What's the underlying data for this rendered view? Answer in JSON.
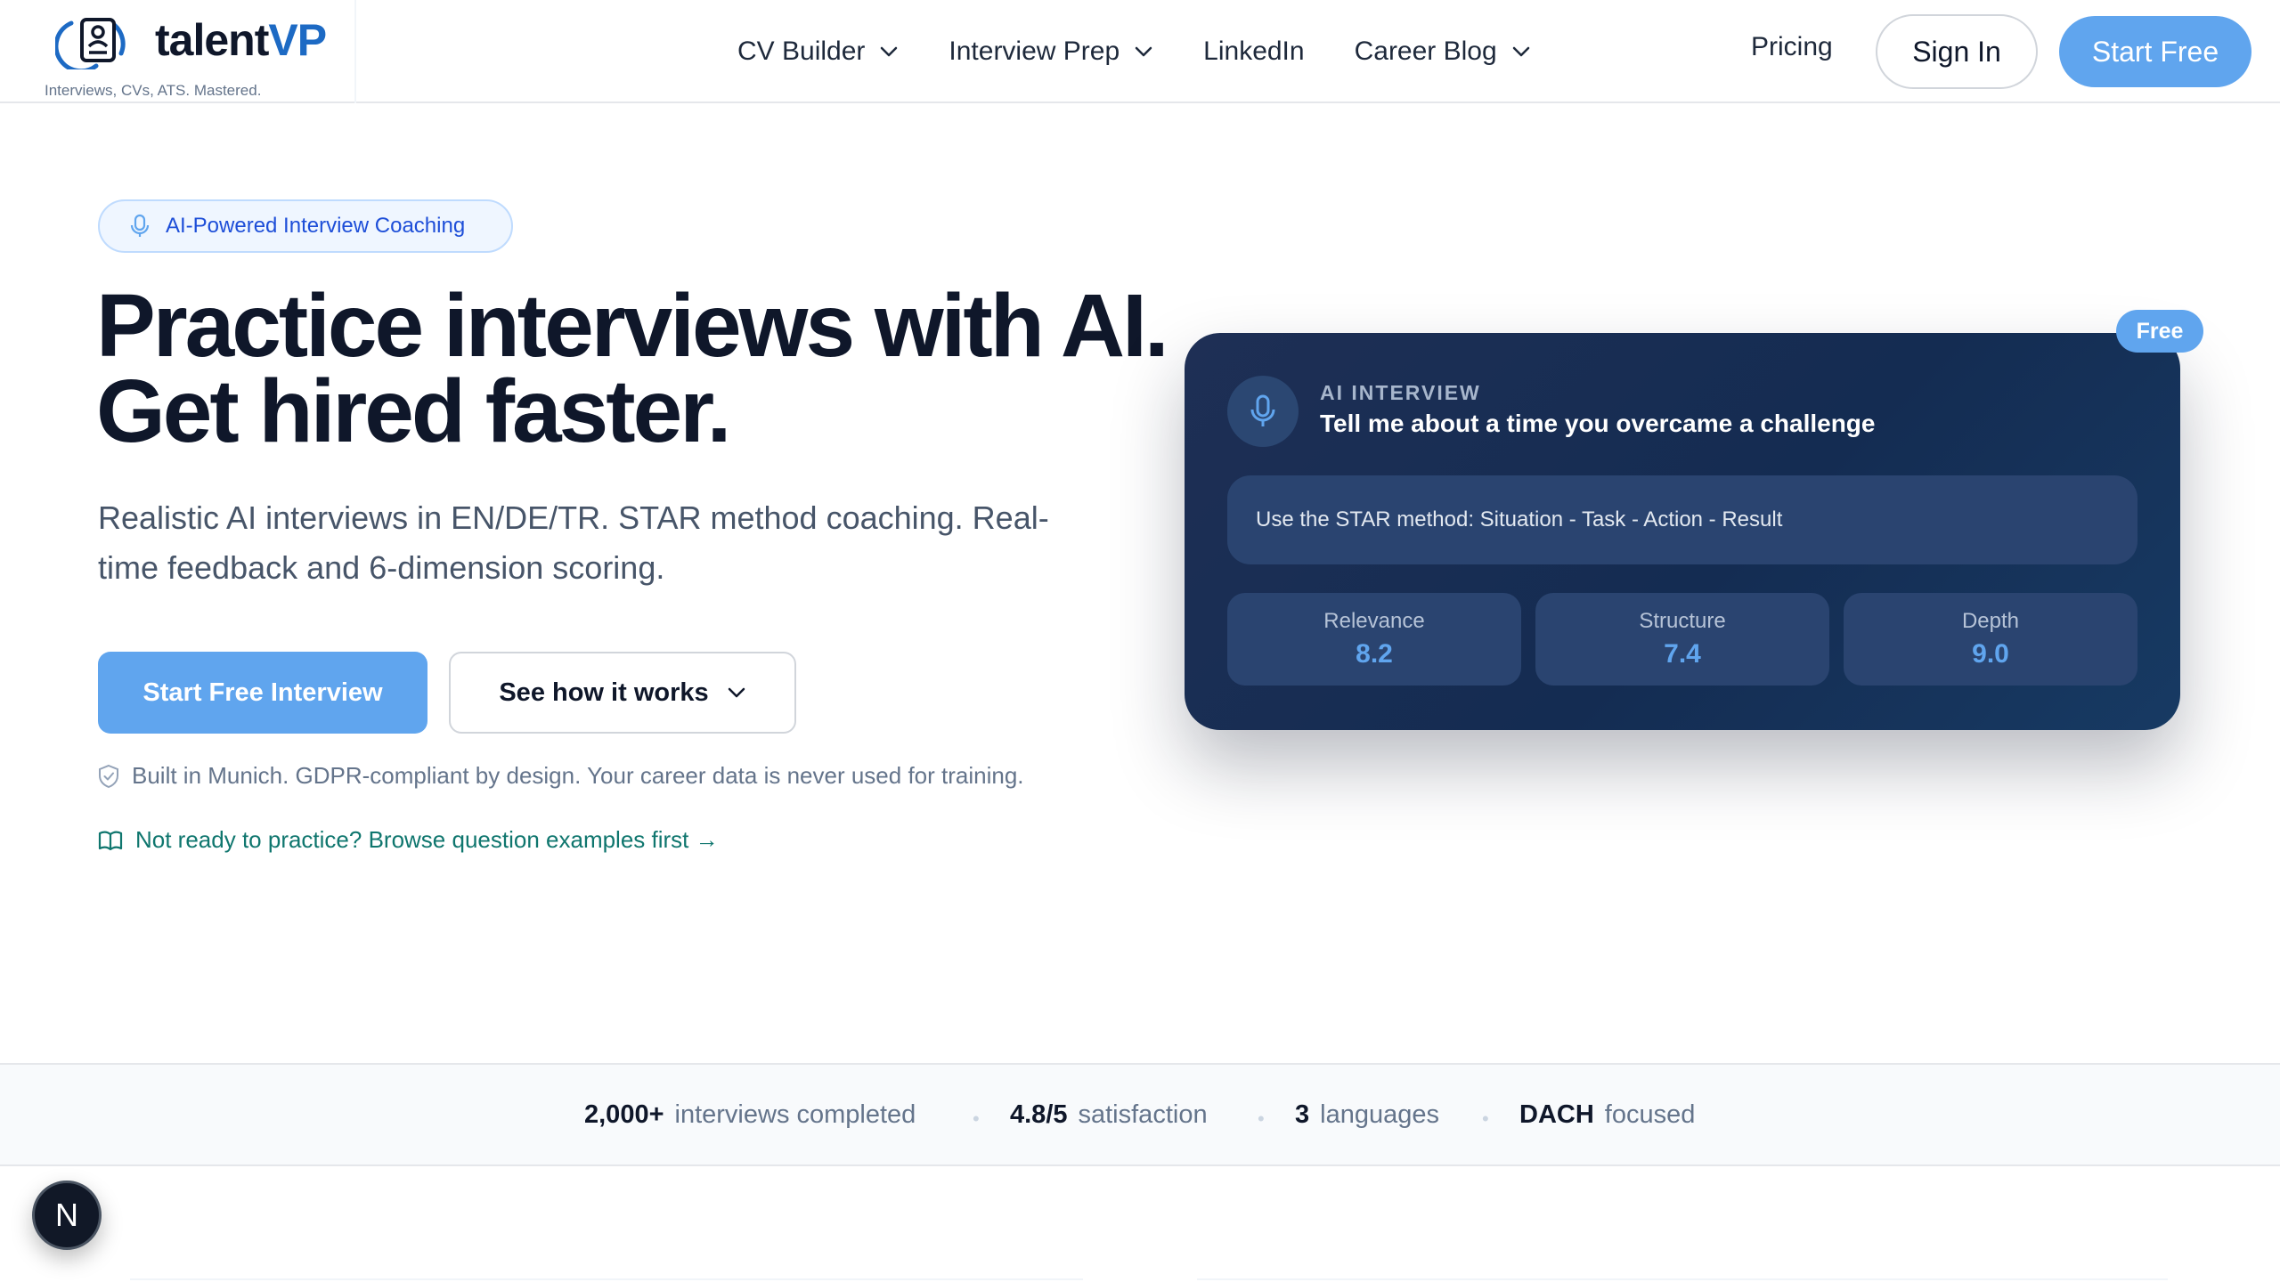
{
  "brand": {
    "name_part1": "talent",
    "name_part2": "VP",
    "tagline": "Interviews, CVs, ATS. Mastered."
  },
  "nav": {
    "items": [
      {
        "label": "CV Builder",
        "has_dropdown": true
      },
      {
        "label": "Interview Prep",
        "has_dropdown": true
      },
      {
        "label": "LinkedIn",
        "has_dropdown": false
      },
      {
        "label": "Career Blog",
        "has_dropdown": true
      }
    ],
    "pricing": "Pricing",
    "sign_in": "Sign In",
    "start_free": "Start Free"
  },
  "hero": {
    "badge": "AI-Powered Interview Coaching",
    "headline_line1": "Practice interviews with AI.",
    "headline_line2": "Get hired faster.",
    "subtext": "Realistic AI interviews in EN/DE/TR. STAR method coaching. Real-time feedback and 6-dimension scoring.",
    "primary_cta": "Start Free Interview",
    "secondary_cta": "See how it works",
    "trust_note": "Built in Munich. GDPR-compliant by design. Your career data is never used for training.",
    "browse_link": "Not ready to practice? Browse question examples first →"
  },
  "interview_card": {
    "free_label": "Free",
    "kicker": "AI INTERVIEW",
    "question": "Tell me about a time you overcame a challenge",
    "hint": "Use the STAR method: Situation - Task - Action - Result",
    "scores": [
      {
        "label": "Relevance",
        "value": "8.2"
      },
      {
        "label": "Structure",
        "value": "7.4"
      },
      {
        "label": "Depth",
        "value": "9.0"
      }
    ]
  },
  "stats": [
    {
      "value": "2,000+",
      "label": "interviews completed"
    },
    {
      "value": "4.8/5",
      "label": "satisfaction"
    },
    {
      "value": "3",
      "label": "languages"
    },
    {
      "value": "DACH",
      "label": "focused"
    }
  ],
  "dev_badge": "N",
  "colors": {
    "accent": "#60a5ee",
    "brand_blue": "#1d6ac4",
    "card_bg": "#1e3358",
    "link_teal": "#0f766e"
  }
}
